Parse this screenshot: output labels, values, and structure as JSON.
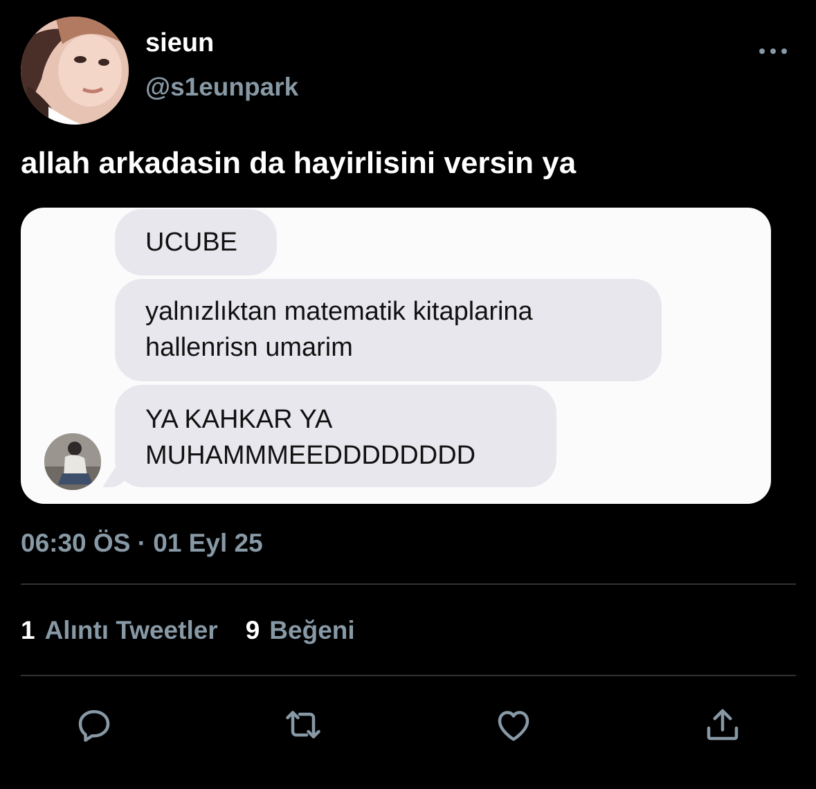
{
  "header": {
    "display_name": "sieun",
    "handle": "@s1eunpark"
  },
  "tweet": {
    "text": "allah arkadasin da hayirlisini versin ya"
  },
  "chat": {
    "messages": [
      {
        "lines": [
          "UCUBE"
        ]
      },
      {
        "lines": [
          "yalnızlıktan matematik kitaplarina",
          "hallenrisn umarim"
        ]
      },
      {
        "lines": [
          "YA KAHKAR YA",
          "MUHAMMMEEDDDDDDDD"
        ]
      }
    ]
  },
  "meta": {
    "timestamp": "06:30 ÖS · 01 Eyl 25"
  },
  "stats": {
    "quotes_count": "1",
    "quotes_label": "Alıntı Tweetler",
    "likes_count": "9",
    "likes_label": "Beğeni"
  },
  "actions": {
    "icons": [
      "reply-icon",
      "retweet-icon",
      "like-icon",
      "share-icon"
    ]
  },
  "colors": {
    "background": "#000000",
    "muted_text": "#8899a6",
    "bubble": "#e8e7ee",
    "divider": "#2f3336"
  }
}
